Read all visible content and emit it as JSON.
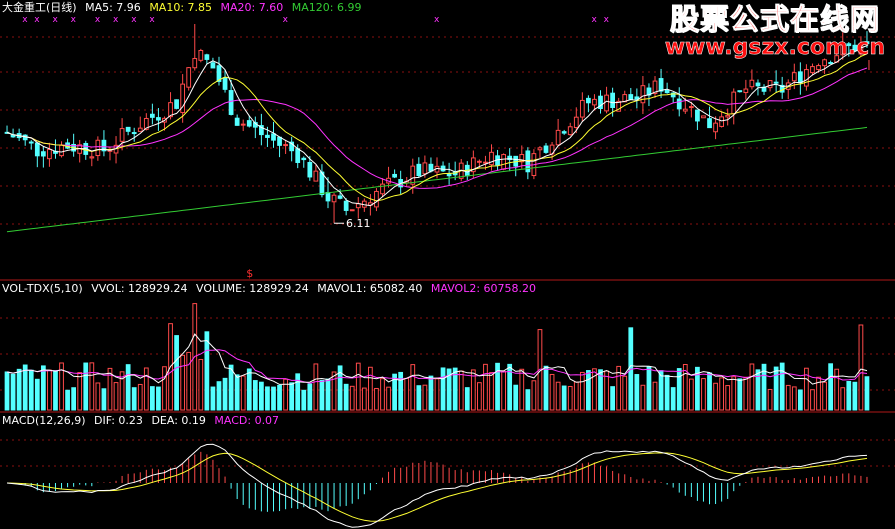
{
  "colors": {
    "up": "#ff4a4a",
    "down": "#54ffff",
    "ma5": "#ffffff",
    "ma10": "#ffff33",
    "ma20": "#ff33ff",
    "ma120": "#33cc33",
    "grid": "#8a1010",
    "text": "#ffffff"
  },
  "price_header": {
    "title": "大金重工(日线)",
    "ma5": "MA5: 7.96",
    "ma10": "MA10: 7.85",
    "ma20": "MA20: 7.60",
    "ma120": "MA120: 6.99"
  },
  "vol_header": {
    "name": "VOL-TDX(5,10)",
    "vvol": "VVOL: 128929.24",
    "volume": "VOLUME: 128929.24",
    "mavol1": "MAVOL1: 65082.40",
    "mavol2": "MAVOL2: 60758.20"
  },
  "macd_header": {
    "name": "MACD(12,26,9)",
    "dif": "DIF: 0.23",
    "dea": "DEA: 0.19",
    "macd": "MACD: 0.07"
  },
  "low_label": "6.11",
  "signal_mark": "$",
  "watermark": {
    "line1": "股票公式在线网",
    "line2": "www.gszx.com.cn"
  },
  "chart_data": {
    "type": "candlestick",
    "low_annotation": 6.11,
    "indicator_last": {
      "ma5": 7.96,
      "ma10": 7.85,
      "ma20": 7.6,
      "ma120": 6.99,
      "vvol": 128929.24,
      "volume": 128929.24,
      "mavol1": 65082.4,
      "mavol2": 60758.2,
      "dif": 0.23,
      "dea": 0.19,
      "macd": 0.07
    }
  }
}
